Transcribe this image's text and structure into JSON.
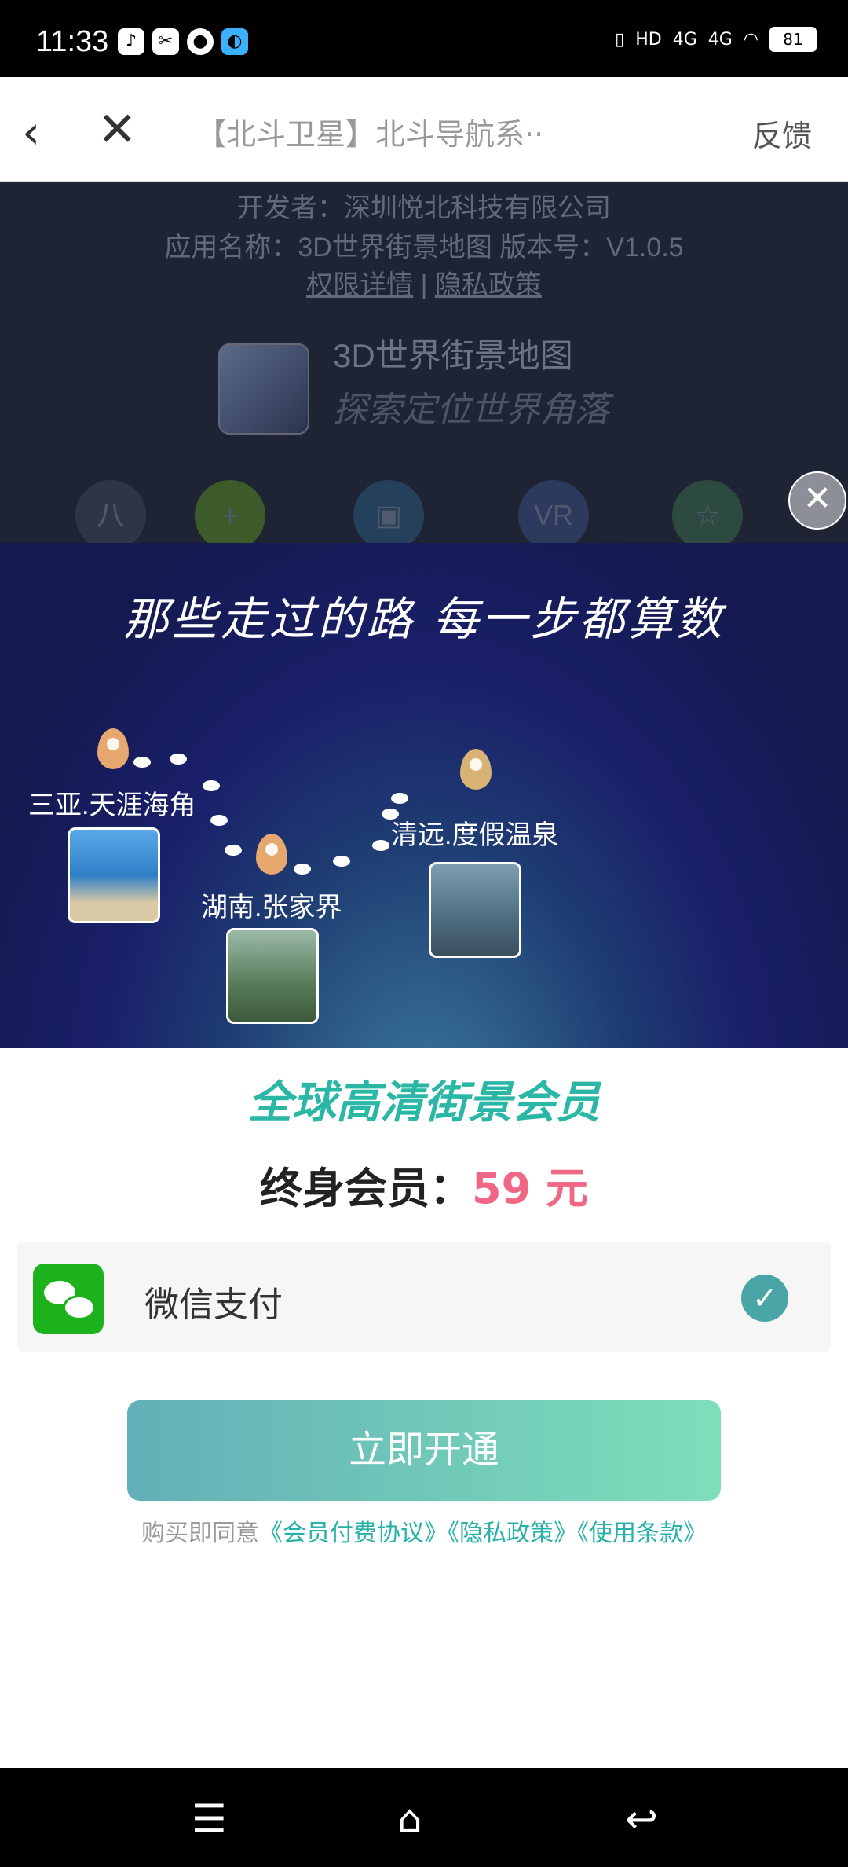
{
  "status_bar": {
    "time": "11:33",
    "network1": "HD",
    "network2": "4G",
    "network3": "4G",
    "battery": "81"
  },
  "nav": {
    "title": "【北斗卫星】北斗导航系··",
    "feedback": "反馈"
  },
  "app_info": {
    "developer": "开发者：深圳悦北科技有限公司",
    "name_version": "应用名称：3D世界街景地图    版本号：V1.0.5",
    "permissions": "权限详情",
    "separator": "|",
    "privacy": "隐私政策",
    "app_name": "3D世界街景地图",
    "app_slogan": "探索定位世界角落",
    "category_1": "八",
    "category_4": "VR"
  },
  "banner": {
    "headline": "那些走过的路 每一步都算数",
    "place_1": "三亚.天涯海角",
    "place_2": "湖南.张家界",
    "place_3": "清远.度假温泉"
  },
  "membership": {
    "title": "全球高清街景会员",
    "price_label": "终身会员：",
    "price_value": "59 元",
    "payment_method": "微信支付",
    "open_button": "立即开通",
    "agree_prefix": "购买即同意",
    "link_1": "《会员付费协议》",
    "link_2": "《隐私政策》",
    "link_3": "《使用条款》"
  }
}
